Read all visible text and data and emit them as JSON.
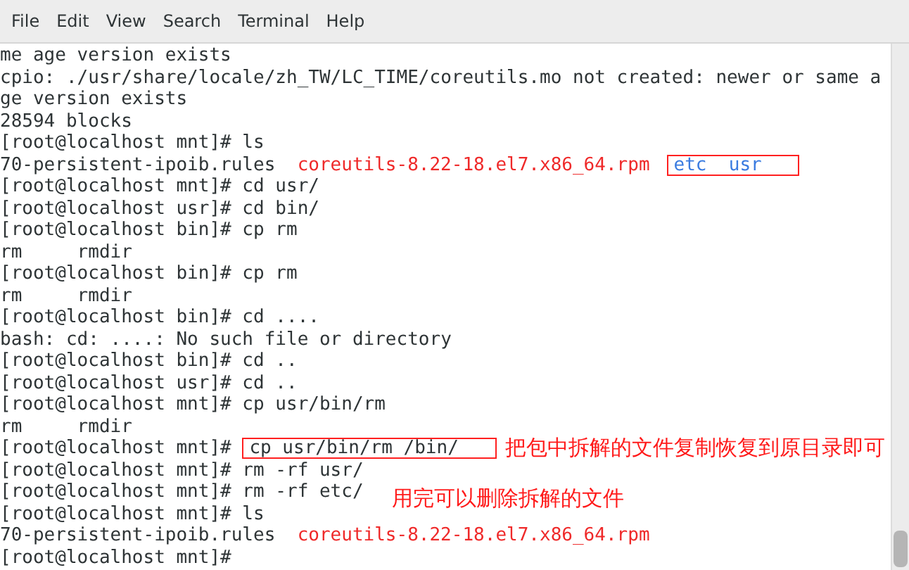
{
  "menu": [
    {
      "label": "File"
    },
    {
      "label": "Edit"
    },
    {
      "label": "View"
    },
    {
      "label": "Search"
    },
    {
      "label": "Terminal"
    },
    {
      "label": "Help"
    }
  ],
  "terminal": {
    "lines": [
      {
        "segments": [
          {
            "text": "me age version exists",
            "kind": "plain",
            "boxed": false
          }
        ]
      },
      {
        "segments": [
          {
            "text": "cpio: ./usr/share/locale/zh_TW/LC_TIME/coreutils.mo not created: newer or same a",
            "kind": "plain",
            "boxed": false
          }
        ]
      },
      {
        "segments": [
          {
            "text": "ge version exists",
            "kind": "plain",
            "boxed": false
          }
        ]
      },
      {
        "segments": [
          {
            "text": "28594 blocks",
            "kind": "plain",
            "boxed": false
          }
        ]
      },
      {
        "segments": [
          {
            "text": "[root@localhost mnt]# ls",
            "kind": "plain",
            "boxed": false
          }
        ]
      },
      {
        "segments": [
          {
            "text": "70-persistent-ipoib.rules",
            "kind": "plain",
            "boxed": false
          },
          {
            "text": "coreutils-8.22-18.el7.x86_64.rpm",
            "kind": "archive",
            "boxed": false
          },
          {
            "text": "etc  usr",
            "kind": "directory",
            "boxed": true
          }
        ]
      },
      {
        "segments": [
          {
            "text": "[root@localhost mnt]# cd usr/",
            "kind": "plain",
            "boxed": false
          }
        ]
      },
      {
        "segments": [
          {
            "text": "[root@localhost usr]# cd bin/",
            "kind": "plain",
            "boxed": false
          }
        ]
      },
      {
        "segments": [
          {
            "text": "[root@localhost bin]# cp rm",
            "kind": "plain",
            "boxed": false
          }
        ]
      },
      {
        "segments": [
          {
            "text": "rm     rmdir",
            "kind": "plain",
            "boxed": false
          }
        ]
      },
      {
        "segments": [
          {
            "text": "[root@localhost bin]# cp rm",
            "kind": "plain",
            "boxed": false
          }
        ]
      },
      {
        "segments": [
          {
            "text": "rm     rmdir",
            "kind": "plain",
            "boxed": false
          }
        ]
      },
      {
        "segments": [
          {
            "text": "[root@localhost bin]# cd ....",
            "kind": "plain",
            "boxed": false
          }
        ]
      },
      {
        "segments": [
          {
            "text": "bash: cd: ....: No such file or directory",
            "kind": "plain",
            "boxed": false
          }
        ]
      },
      {
        "segments": [
          {
            "text": "[root@localhost bin]# cd ..",
            "kind": "plain",
            "boxed": false
          }
        ]
      },
      {
        "segments": [
          {
            "text": "[root@localhost usr]# cd ..",
            "kind": "plain",
            "boxed": false
          }
        ]
      },
      {
        "segments": [
          {
            "text": "[root@localhost mnt]# cp usr/bin/rm",
            "kind": "plain",
            "boxed": false
          }
        ]
      },
      {
        "segments": [
          {
            "text": "rm     rmdir",
            "kind": "plain",
            "boxed": false
          }
        ]
      },
      {
        "segments": [
          {
            "text": "[root@localhost mnt]#",
            "kind": "plain",
            "boxed": false
          },
          {
            "text": "cp usr/bin/rm /bin/",
            "kind": "plain",
            "boxed": true
          }
        ],
        "note": "把包中拆解的文件复制恢复到原目录即可"
      },
      {
        "segments": [
          {
            "text": "[root@localhost mnt]# rm -rf usr/",
            "kind": "plain",
            "boxed": false
          }
        ]
      },
      {
        "segments": [
          {
            "text": "[root@localhost mnt]# rm -rf etc/",
            "kind": "plain",
            "boxed": false
          }
        ],
        "note": "用完可以删除拆解的文件"
      },
      {
        "segments": [
          {
            "text": "[root@localhost mnt]# ls",
            "kind": "plain",
            "boxed": false
          }
        ]
      },
      {
        "segments": [
          {
            "text": "70-persistent-ipoib.rules",
            "kind": "plain",
            "boxed": false
          },
          {
            "text": "coreutils-8.22-18.el7.x86_64.rpm",
            "kind": "archive",
            "boxed": false
          }
        ]
      },
      {
        "segments": [
          {
            "text": "[root@localhost mnt]#",
            "kind": "plain",
            "boxed": false
          }
        ]
      }
    ]
  }
}
